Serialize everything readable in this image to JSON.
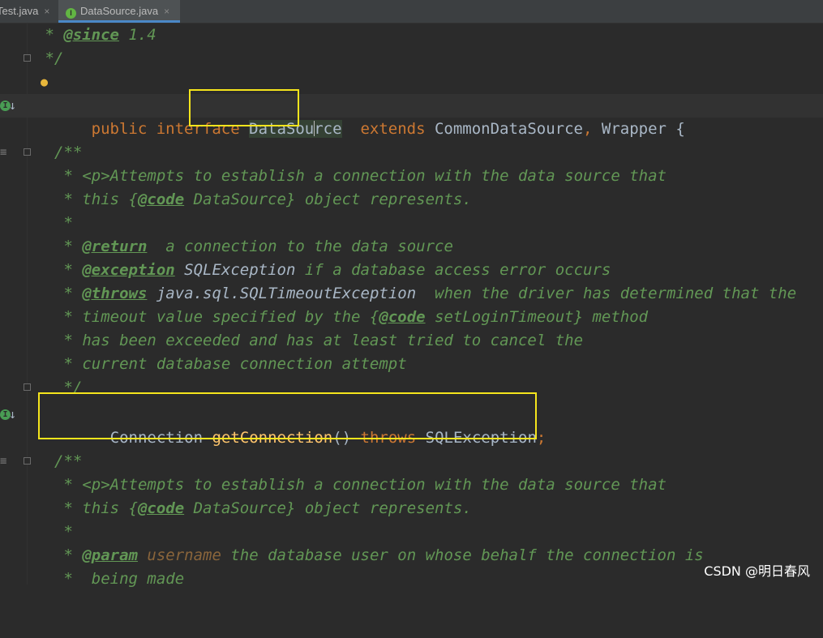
{
  "tabs": [
    {
      "label": "Test.java",
      "close": "×"
    },
    {
      "label": "DataSource.java",
      "close": "×"
    }
  ],
  "code": {
    "l1": {
      "prefix": " * ",
      "tag": "@since",
      "rest": " 1.4"
    },
    "l2": " */",
    "l4": {
      "kw1": "public",
      "kw2": "interface",
      "name_a": "DataSou",
      "name_b": "rce",
      "kw3": "extends",
      "rest": "CommonDataSource",
      "comma": ",",
      "rest2": "Wrapper {"
    },
    "l6": "/**",
    "l7": " * <p>Attempts to establish a connection with the data source that",
    "l8": {
      "a": " * this {",
      "tag": "@code",
      "b": " DataSource} object represents."
    },
    "l9": " *",
    "l10": {
      "a": " * ",
      "tag": "@return",
      "b": "  a connection to the data source"
    },
    "l11": {
      "a": " * ",
      "tag": "@exception",
      "b": " SQLException",
      "c": " if a database access error occurs"
    },
    "l12": {
      "a": " * ",
      "tag": "@throws",
      "b": " java.sql.SQLTimeoutException",
      "c": "  when the driver has determined that the"
    },
    "l13": {
      "a": " * timeout value specified by the {",
      "tag": "@code",
      "b": " setLoginTimeout} method"
    },
    "l14": " * has been exceeded and has at least tried to cancel the",
    "l15": " * current database connection attempt",
    "l16": " */",
    "l17": {
      "type": "Connection",
      "fn": "getConnection",
      "paren": "()",
      "kw": "throws",
      "exc": "SQLException",
      "semi": ";"
    },
    "l19": "/**",
    "l20": " * <p>Attempts to establish a connection with the data source that",
    "l21": {
      "a": " * this {",
      "tag": "@code",
      "b": " DataSource} object represents."
    },
    "l22": " *",
    "l23": {
      "a": " * ",
      "tag": "@param",
      "param": " username",
      "b": " the database user on whose behalf the connection is"
    },
    "l24": " *  being made"
  },
  "icons": {
    "impl": "implemented-icon",
    "bulb": "lightbulb-icon",
    "doc": "rendered-doc-icon",
    "fold": "fold-icon"
  },
  "watermark": "CSDN @明日春风"
}
